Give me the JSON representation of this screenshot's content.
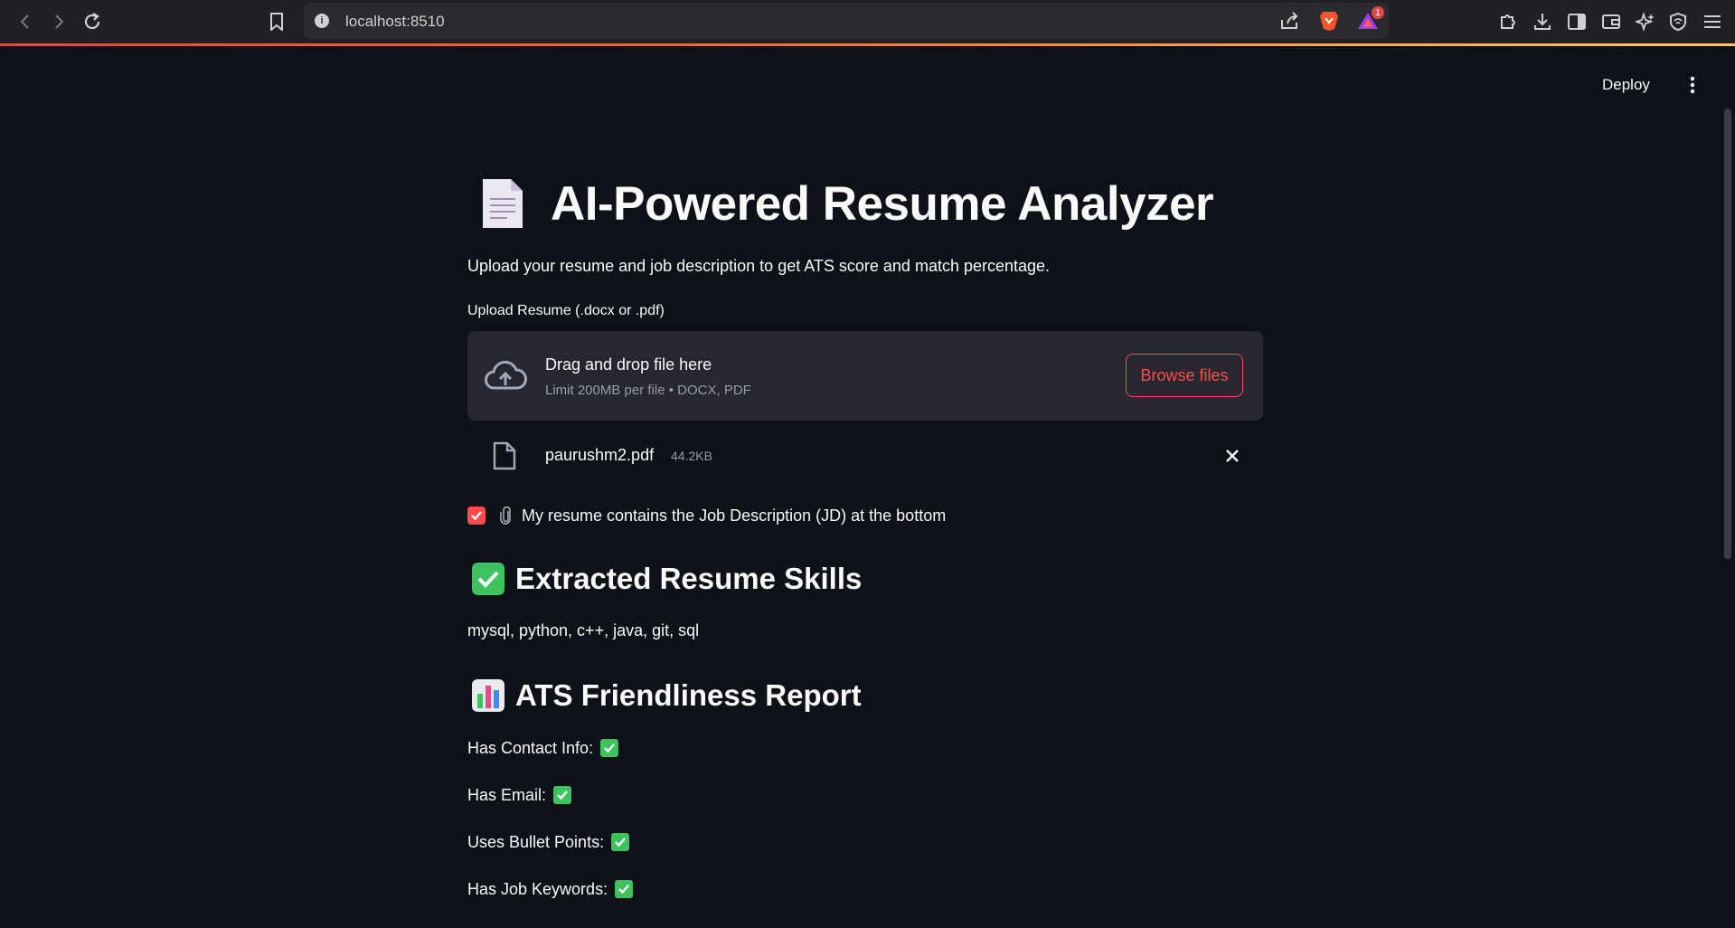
{
  "browser": {
    "url": "localhost:8510",
    "notification_count": "1"
  },
  "header": {
    "deploy_label": "Deploy"
  },
  "main": {
    "title": "AI-Powered Resume Analyzer",
    "subtitle": "Upload your resume and job description to get ATS score and match percentage.",
    "upload": {
      "label": "Upload Resume (.docx or .pdf)",
      "drop_title": "Drag and drop file here",
      "drop_hint": "Limit 200MB per file • DOCX, PDF",
      "browse_label": "Browse files",
      "file": {
        "name": "paurushm2.pdf",
        "size": "44.2KB"
      }
    },
    "jd_checkbox": {
      "label": "My resume contains the Job Description (JD) at the bottom",
      "checked": true
    },
    "skills_section": {
      "heading": "Extracted Resume Skills",
      "skills_text": "mysql, python, c++, java, git, sql"
    },
    "ats_section": {
      "heading": "ATS Friendliness Report",
      "items": [
        {
          "label": "Has Contact Info:",
          "passed": true
        },
        {
          "label": "Has Email:",
          "passed": true
        },
        {
          "label": "Uses Bullet Points:",
          "passed": true
        },
        {
          "label": "Has Job Keywords:",
          "passed": true
        }
      ]
    }
  },
  "colors": {
    "background": "#0e1117",
    "accent": "#ff4b4b",
    "success": "#3ec25e",
    "panel": "#262730"
  }
}
